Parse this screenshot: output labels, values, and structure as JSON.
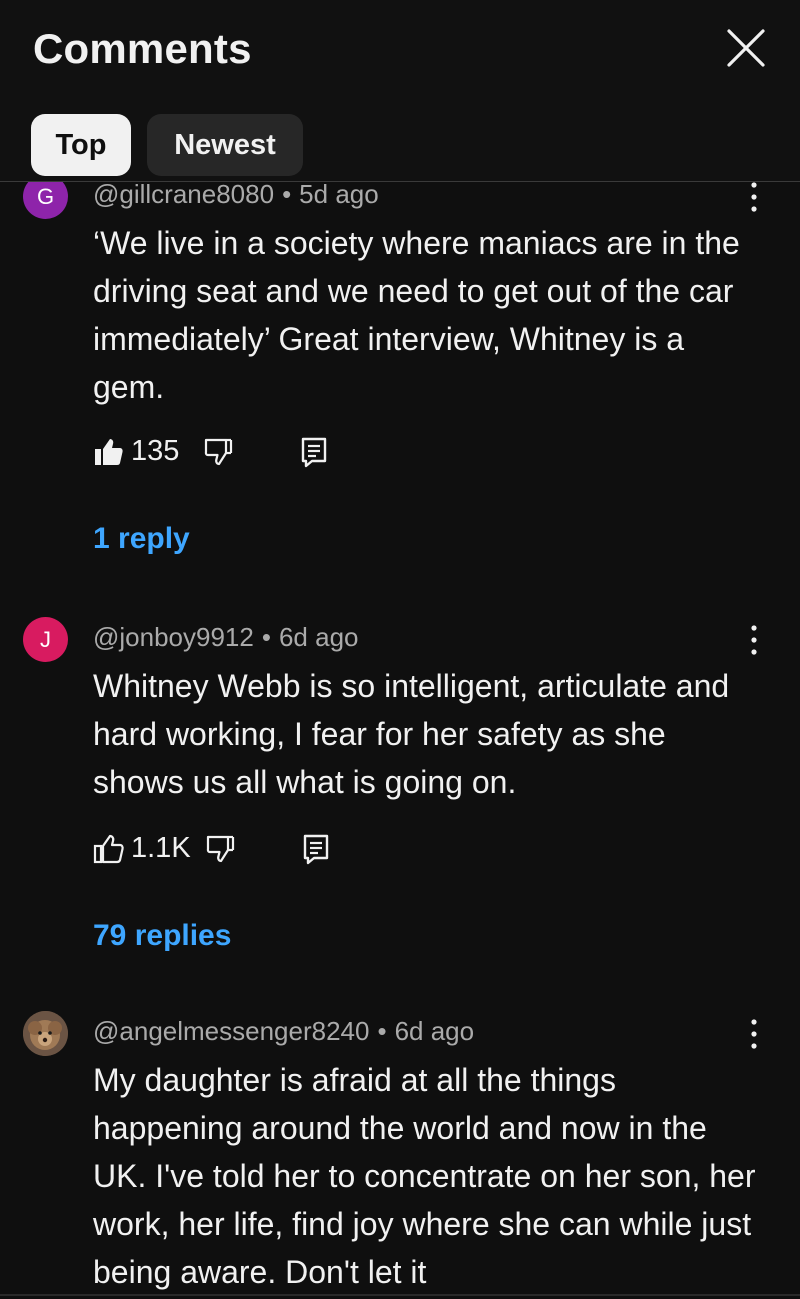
{
  "header": {
    "title": "Comments",
    "close_icon": "close-icon"
  },
  "tabs": [
    {
      "label": "Top",
      "selected": true
    },
    {
      "label": "Newest",
      "selected": false
    }
  ],
  "colors": {
    "background": "#0f0f0f",
    "link": "#3ea6ff",
    "avatar_g": "#8e24aa",
    "avatar_j": "#d81b60"
  },
  "comments": [
    {
      "avatar_letter": "G",
      "handle": "@gillcrane8080",
      "time": "5d ago",
      "text": "‘We live in a society where maniacs are in the driving seat and we need to get out of the car immediately’ Great interview, Whitney is a gem.",
      "likes": "135",
      "liked": true,
      "replies": "1 reply"
    },
    {
      "avatar_letter": "J",
      "handle": "@jonboy9912",
      "time": "6d ago",
      "text": "Whitney Webb is so intelligent, articulate and hard working, I fear for her safety as she shows us all what is going on.",
      "likes": "1.1K",
      "liked": false,
      "replies": "79 replies"
    },
    {
      "avatar_letter": "",
      "handle": "@angelmessenger8240",
      "time": "6d ago",
      "text": "My daughter is afraid at all the things happening around the world and now in the UK. I've told her to concentrate on her son, her work, her life, find joy where she can while just being aware. Don't let it"
    }
  ]
}
